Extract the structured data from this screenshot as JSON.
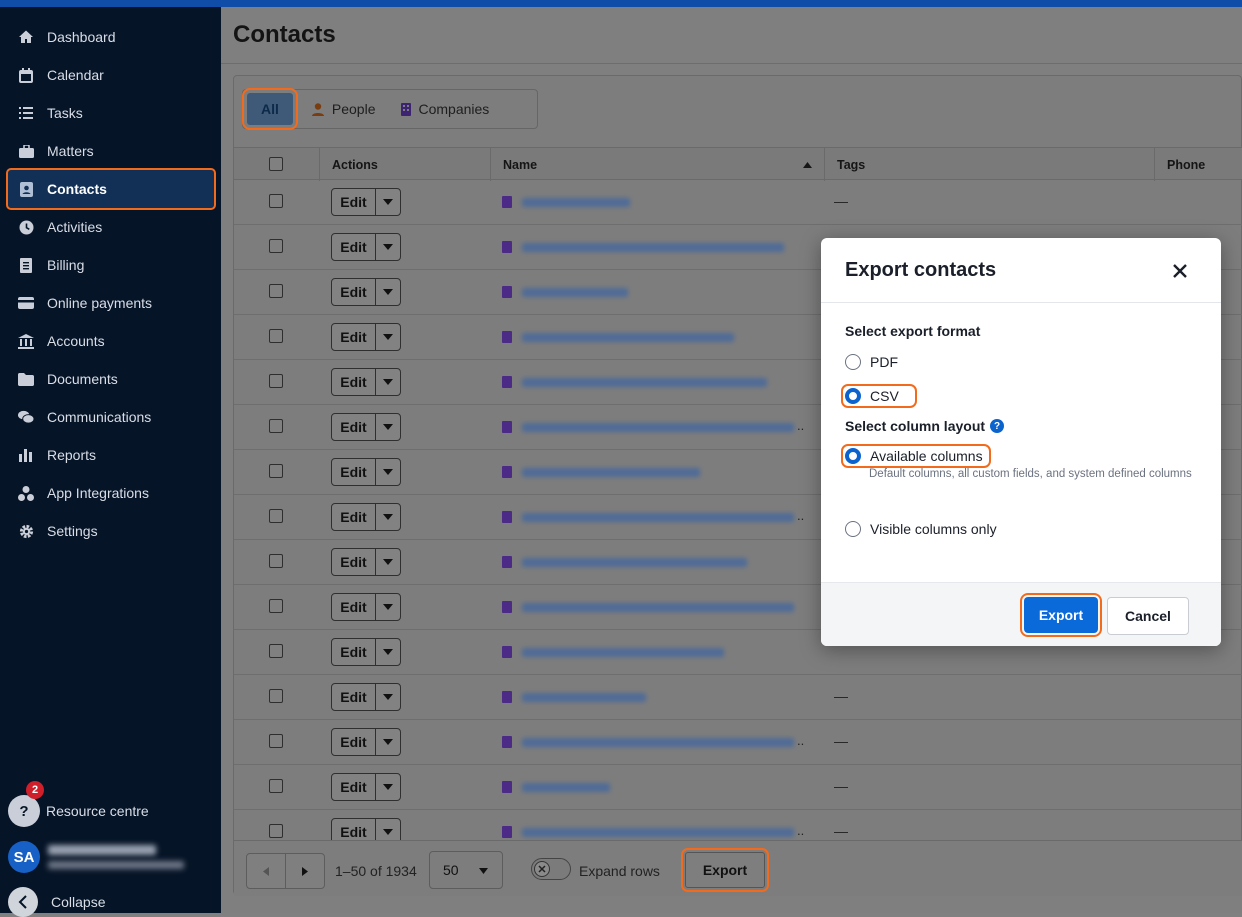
{
  "colors": {
    "accent": "#0b6ad9",
    "highlight": "#f26b1d",
    "sidebar_bg": "#061427",
    "building_icon": "#6b3fc2"
  },
  "sidebar": {
    "items": [
      {
        "label": "Dashboard",
        "icon": "home-icon"
      },
      {
        "label": "Calendar",
        "icon": "calendar-icon"
      },
      {
        "label": "Tasks",
        "icon": "list-icon"
      },
      {
        "label": "Matters",
        "icon": "briefcase-icon"
      },
      {
        "label": "Contacts",
        "icon": "contact-card-icon",
        "active": true
      },
      {
        "label": "Activities",
        "icon": "clock-icon"
      },
      {
        "label": "Billing",
        "icon": "receipt-icon"
      },
      {
        "label": "Online payments",
        "icon": "credit-card-icon"
      },
      {
        "label": "Accounts",
        "icon": "bank-icon"
      },
      {
        "label": "Documents",
        "icon": "folder-icon"
      },
      {
        "label": "Communications",
        "icon": "chat-icon"
      },
      {
        "label": "Reports",
        "icon": "bar-chart-icon"
      },
      {
        "label": "App Integrations",
        "icon": "puzzle-icon"
      },
      {
        "label": "Settings",
        "icon": "gear-icon"
      }
    ],
    "resource_centre": {
      "label": "Resource centre",
      "badge": "2"
    },
    "user": {
      "initials": "SA"
    },
    "collapse": "Collapse"
  },
  "page": {
    "title": "Contacts"
  },
  "filter_tabs": {
    "all": "All",
    "people": "People",
    "companies": "Companies"
  },
  "table": {
    "columns": [
      "Actions",
      "Name",
      "Tags",
      "Phone"
    ],
    "edit_label": "Edit",
    "empty_tag": "—",
    "ellipsis": ".."
  },
  "footer": {
    "range": "1–50 of 1934",
    "page_size": "50",
    "expand_rows": "Expand rows",
    "export": "Export"
  },
  "dialog": {
    "title": "Export contacts",
    "format_label": "Select export format",
    "format_options": [
      "PDF",
      "CSV"
    ],
    "format_selected": "CSV",
    "layout_label": "Select column layout",
    "layout_help": "?",
    "layout_options": [
      "Available columns",
      "Visible columns only"
    ],
    "layout_selected": "Available columns",
    "layout_hint": "Default columns, all custom fields, and system defined columns",
    "export_button": "Export",
    "cancel_button": "Cancel"
  }
}
